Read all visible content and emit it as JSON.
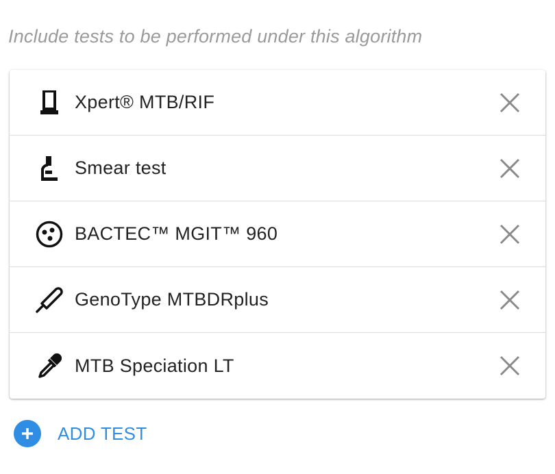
{
  "hint": "Include tests to be performed under this algorithm",
  "tests": [
    {
      "label": "Xpert® MTB/RIF",
      "icon": "cartridge-icon"
    },
    {
      "label": "Smear test",
      "icon": "microscope-icon"
    },
    {
      "label": "BACTEC™ MGIT™ 960",
      "icon": "culture-dish-icon"
    },
    {
      "label": "GenoType MTBDRplus",
      "icon": "probe-icon"
    },
    {
      "label": "MTB Speciation LT",
      "icon": "dropper-icon"
    }
  ],
  "add_button": {
    "label": "ADD TEST"
  },
  "colors": {
    "accent": "#2f8de4",
    "hint": "#9a9a9a",
    "remove": "#8a8a8a",
    "text": "#222222"
  }
}
